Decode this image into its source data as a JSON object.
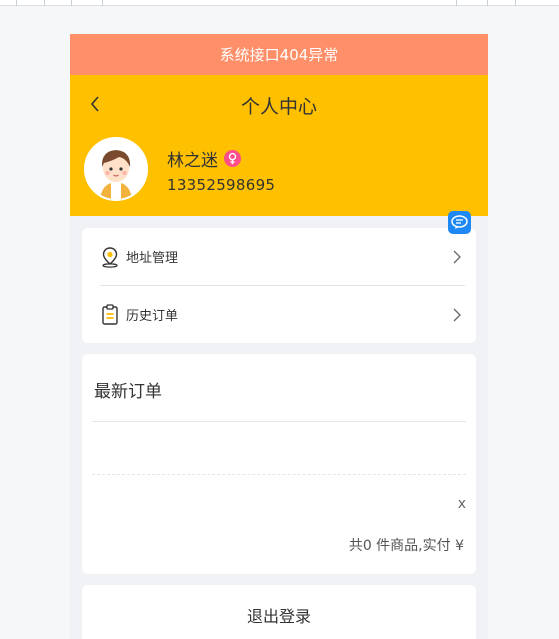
{
  "banner": {
    "error_text": "系统接口404异常"
  },
  "header": {
    "title": "个人中心",
    "user_name": "林之迷",
    "phone": "13352598695"
  },
  "menu": {
    "items": [
      {
        "label": "地址管理",
        "icon": "location-pin-icon"
      },
      {
        "label": "历史订单",
        "icon": "clipboard-icon"
      }
    ]
  },
  "orders": {
    "title": "最新订单",
    "close_label": "x",
    "summary": "共0 件商品,实付 ¥"
  },
  "logout": {
    "label": "退出登录"
  },
  "colors": {
    "banner": "#ff8f68",
    "header": "#ffc000",
    "background": "#f1f2f6",
    "float_icon": "#1e88f5",
    "gender_badge": "#ff4f8b"
  }
}
